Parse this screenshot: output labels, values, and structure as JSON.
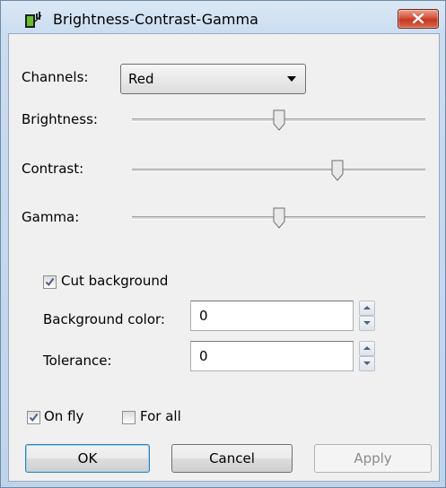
{
  "window": {
    "title": "Brightness-Contrast-Gamma",
    "close_glyph": "✕"
  },
  "channels": {
    "label": "Channels:",
    "selected": "Red"
  },
  "sliders": [
    {
      "label": "Brightness:",
      "value": 0.5
    },
    {
      "label": "Contrast:",
      "value": 0.7
    },
    {
      "label": "Gamma:",
      "value": 0.5
    }
  ],
  "cut_background": {
    "label": "Cut background",
    "checked": true
  },
  "background_color": {
    "label": "Background color:",
    "value": "0"
  },
  "tolerance": {
    "label": "Tolerance:",
    "value": "0"
  },
  "on_fly": {
    "label": "On fly",
    "checked": true
  },
  "for_all": {
    "label": "For all",
    "checked": false
  },
  "buttons": {
    "ok": "OK",
    "cancel": "Cancel",
    "apply": "Apply"
  },
  "colors": {
    "accent": "#3c7fb1",
    "check": "#4a5d86",
    "close": "#c5371f"
  }
}
